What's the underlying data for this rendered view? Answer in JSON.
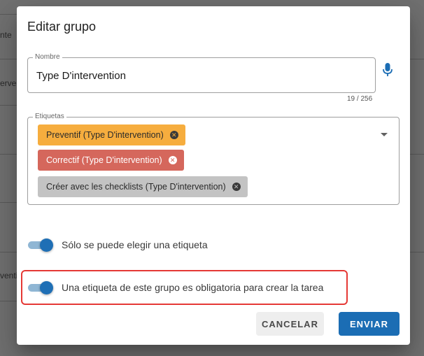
{
  "background": {
    "row_fragments": [
      "nte",
      "erve",
      "venti"
    ]
  },
  "dialog": {
    "title": "Editar grupo",
    "name_field": {
      "legend": "Nombre",
      "value": "Type D'intervention",
      "counter": "19 / 256"
    },
    "tags_field": {
      "legend": "Etiquetas",
      "chips": [
        {
          "label": "Preventif (Type D'intervention)",
          "color": "#f6ad3e"
        },
        {
          "label": "Correctif (Type D'intervention)",
          "color": "#d5675c"
        },
        {
          "label": "Créer avec les checklists (Type D'intervention)",
          "color": "#c3c3c3"
        }
      ]
    },
    "toggles": [
      {
        "label": "Sólo se puede elegir una etiqueta",
        "on": true
      },
      {
        "label": "Una etiqueta de este grupo es obligatoria para crear la tarea",
        "on": true
      }
    ],
    "buttons": {
      "cancel": "CANCELAR",
      "send": "ENVIAR"
    }
  },
  "colors": {
    "accent": "#1b6db4",
    "highlight": "#e53935"
  },
  "icons": {
    "mic": "microphone-icon",
    "dropdown": "chevron-down-icon",
    "chip_remove": "close-circle-icon"
  }
}
